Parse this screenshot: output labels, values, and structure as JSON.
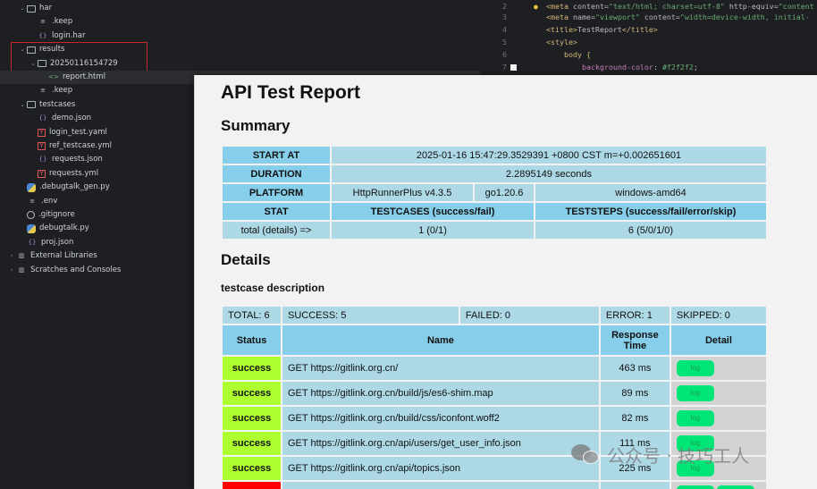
{
  "tree": [
    {
      "label": "har",
      "icon": "folder-icon",
      "arrow": "⌄",
      "indent": 1
    },
    {
      "label": ".keep",
      "icon": "lines-icon",
      "arrow": "",
      "indent": 2
    },
    {
      "label": "login.har",
      "icon": "json-icon",
      "arrow": "",
      "indent": 2
    },
    {
      "label": "results",
      "icon": "folder-icon",
      "arrow": "⌄",
      "indent": 1
    },
    {
      "label": "20250116154729",
      "icon": "folder-icon",
      "arrow": "⌄",
      "indent": 2
    },
    {
      "label": "report.html",
      "icon": "html-icon",
      "arrow": "",
      "indent": 3
    },
    {
      "label": ".keep",
      "icon": "lines-icon",
      "arrow": "",
      "indent": 2
    },
    {
      "label": "testcases",
      "icon": "folder-icon",
      "arrow": "⌄",
      "indent": 1
    },
    {
      "label": "demo.json",
      "icon": "json-icon",
      "arrow": "",
      "indent": 2
    },
    {
      "label": "login_test.yaml",
      "icon": "yaml-icon",
      "arrow": "",
      "indent": 2
    },
    {
      "label": "ref_testcase.yml",
      "icon": "yaml-icon",
      "arrow": "",
      "indent": 2
    },
    {
      "label": "requests.json",
      "icon": "json-icon",
      "arrow": "",
      "indent": 2
    },
    {
      "label": "requests.yml",
      "icon": "yaml-icon",
      "arrow": "",
      "indent": 2
    },
    {
      "label": ".debugtalk_gen.py",
      "icon": "py-icon",
      "arrow": "",
      "indent": 1
    },
    {
      "label": ".env",
      "icon": "lines-icon",
      "arrow": "",
      "indent": 1
    },
    {
      "label": ".gitignore",
      "icon": "ignore-icon",
      "arrow": "",
      "indent": 1
    },
    {
      "label": "debugtalk.py",
      "icon": "py-icon",
      "arrow": "",
      "indent": 1
    },
    {
      "label": "proj.json",
      "icon": "json-icon",
      "arrow": "",
      "indent": 1
    },
    {
      "label": "External Libraries",
      "icon": "lib-icon",
      "arrow": "›",
      "indent": 0
    },
    {
      "label": "Scratches and Consoles",
      "icon": "lib-icon",
      "arrow": "›",
      "indent": 0
    }
  ],
  "editor": {
    "line_numbers": [
      "2",
      "3",
      "4",
      "5",
      "6",
      "7"
    ],
    "l2_tag_open": "<meta ",
    "l2_attr1": "content=",
    "l2_str1": "\"text/html; charset=utf-8\"",
    "l2_attr2": " http-equiv=",
    "l2_str2": "\"content",
    "l3_tag_open": "<meta ",
    "l3_attr1": "name=",
    "l3_str1": "\"viewport\"",
    "l3_attr2": " content=",
    "l3_str2": "\"width=device-width, initial-",
    "l4_tag": "<title>",
    "l4_txt": "TestReport",
    "l4_tag_close": "</title>",
    "l5_tag": "<style>",
    "l6_txt": "body {",
    "l7_prop": "background-color",
    "l7_colon": ": ",
    "l7_val": "#f2f2f2",
    "l7_end": ";"
  },
  "report": {
    "title": "API Test Report",
    "summary_heading": "Summary",
    "summary": {
      "start_at_label": "START AT",
      "start_at_value": "2025-01-16 15:47:29.3529391 +0800 CST m=+0.002651601",
      "duration_label": "DURATION",
      "duration_value": "2.2895149 seconds",
      "platform_label": "PLATFORM",
      "platform_values": [
        "HttpRunnerPlus v4.3.5",
        "go1.20.6",
        "windows-amd64"
      ],
      "stat_label": "STAT",
      "testcases_header": "TESTCASES (success/fail)",
      "teststeps_header": "TESTSTEPS (success/fail/error/skip)",
      "total_label": "total (details) =>",
      "testcases_value": "1 (0/1)",
      "teststeps_value": "6 (5/0/1/0)"
    },
    "details_heading": "Details",
    "testcase_name": "testcase description",
    "counts": {
      "total": "TOTAL: 6",
      "success": "SUCCESS: 5",
      "failed": "FAILED: 0",
      "error": "ERROR: 1",
      "skipped": "SKIPPED: 0"
    },
    "columns": {
      "status": "Status",
      "name": "Name",
      "response_time": "Response Time",
      "detail": "Detail"
    },
    "steps": [
      {
        "status": "success",
        "name": "GET https://gitlink.org.cn/",
        "time": "463 ms",
        "detail": "log"
      },
      {
        "status": "success",
        "name": "GET https://gitlink.org.cn/build/js/es6-shim.map",
        "time": "89 ms",
        "detail": "log"
      },
      {
        "status": "success",
        "name": "GET https://gitlink.org.cn/build/css/iconfont.woff2",
        "time": "82 ms",
        "detail": "log"
      },
      {
        "status": "success",
        "name": "GET https://gitlink.org.cn/api/users/get_user_info.json",
        "time": "111 ms",
        "detail": "log"
      },
      {
        "status": "success",
        "name": "GET https://gitlink.org.cn/api/topics.json",
        "time": "225 ms",
        "detail": "log"
      }
    ]
  },
  "watermark": {
    "text": "公众号 · 技巧工人"
  }
}
